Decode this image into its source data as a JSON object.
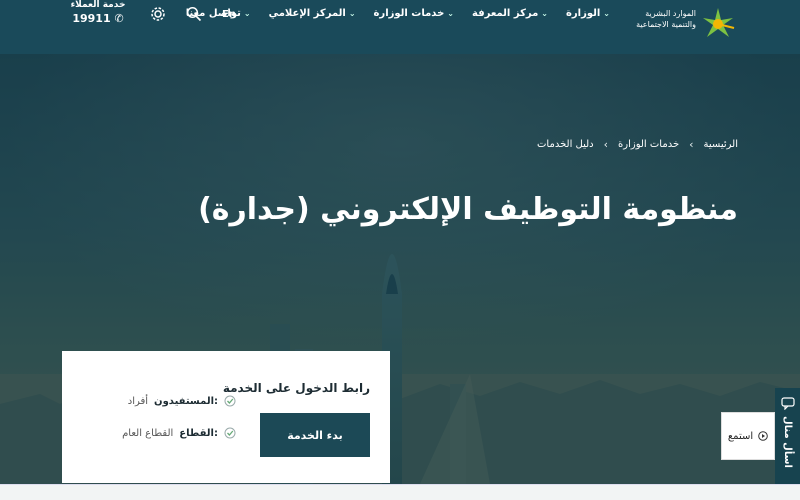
{
  "header": {
    "logo_text": [
      "الموارد البشرية",
      "والتنمية الاجتماعية"
    ],
    "nav": [
      {
        "label": "الوزارة"
      },
      {
        "label": "مركز المعرفة"
      },
      {
        "label": "خدمات الوزارة"
      },
      {
        "label": "المركز الإعلامي"
      },
      {
        "label": "تواصل معنا"
      }
    ],
    "lang_label": "En",
    "support_title": "خدمة العملاء",
    "support_number": "19911"
  },
  "breadcrumb": [
    "الرئيسية",
    "خدمات الوزارة",
    "دليل الخدمات"
  ],
  "page_title": "منظومة التوظيف الإلكتروني (جدارة)",
  "card": {
    "title": "رابط الدخول على الخدمة",
    "button": "بدء الخدمة",
    "beneficiaries_label": "المستفيدون:",
    "beneficiaries_value": "أفراد",
    "sector_label": "القطاع:",
    "sector_value": "القطاع العام"
  },
  "listen_label": "استمع",
  "side_tab_label": "اسأل منال",
  "colors": {
    "header_bg": "#1a4a5a",
    "button_bg": "#1c4956",
    "accent_green": "#7dc242",
    "accent_yellow": "#f2b705"
  }
}
